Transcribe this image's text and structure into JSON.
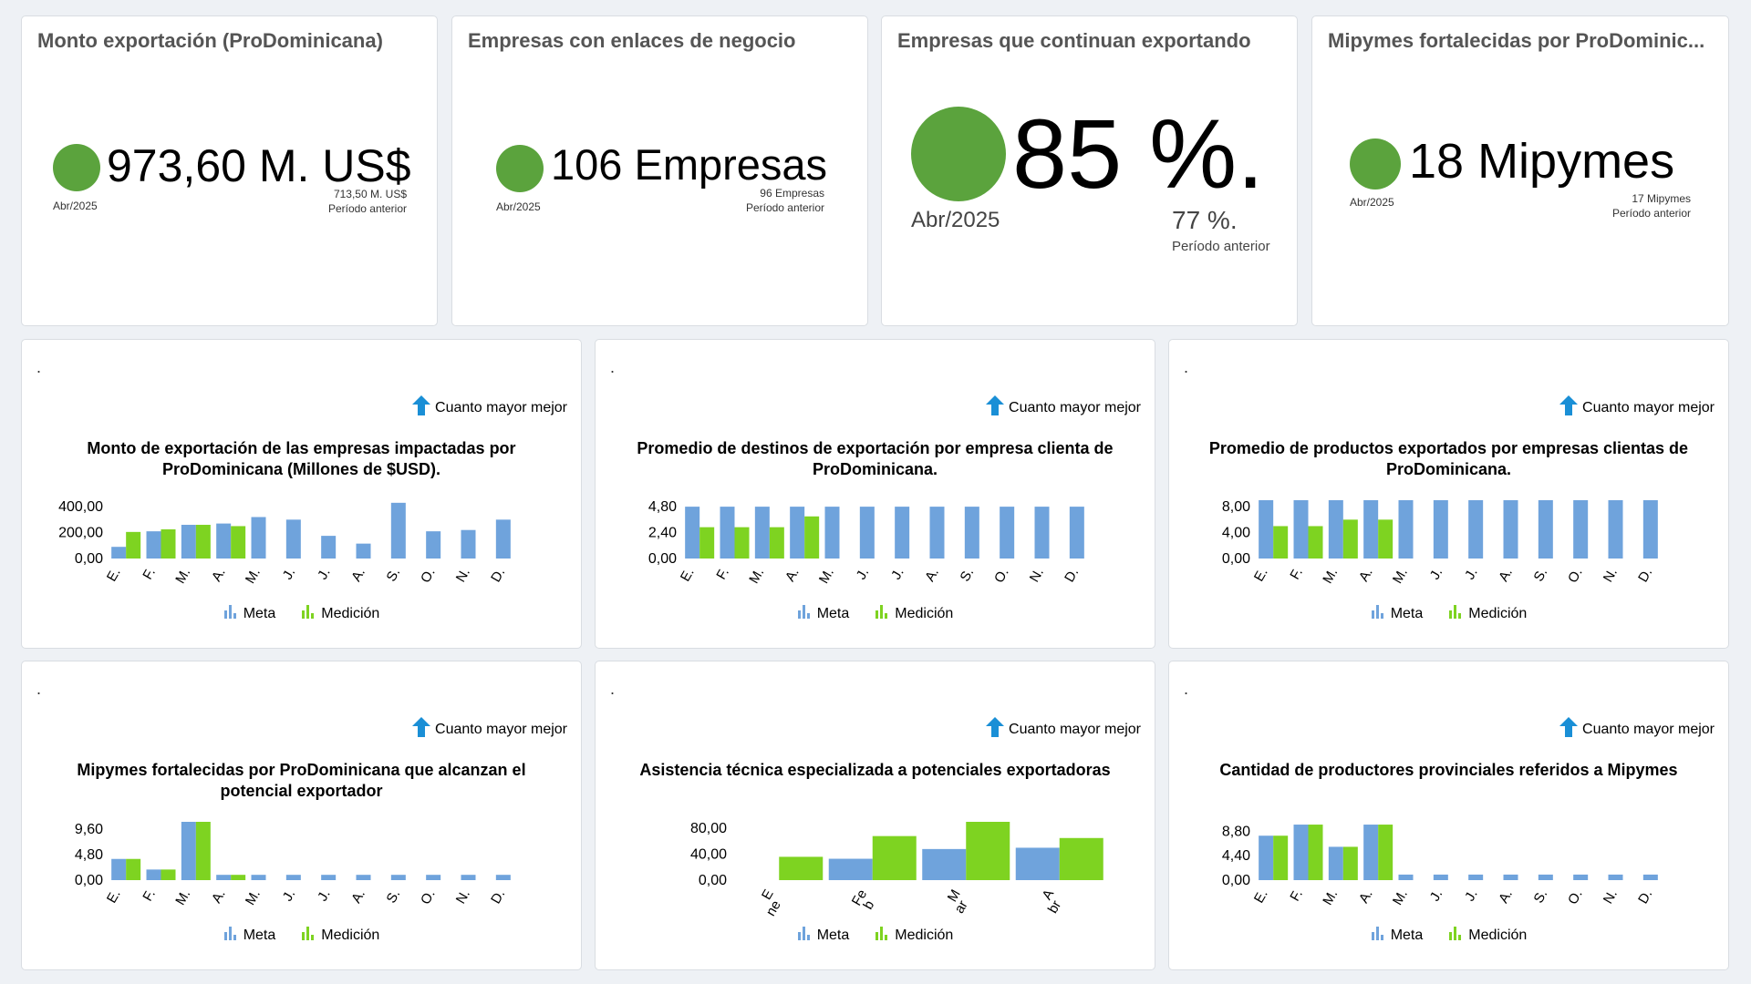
{
  "kpis": [
    {
      "title": "Monto exportación (ProDominicana)",
      "value": "973,60 M. US$",
      "period": "Abr/2025",
      "prev_value": "713,50 M. US$",
      "prev_label": "Período anterior"
    },
    {
      "title": "Empresas con enlaces de negocio",
      "value": "106 Empresas",
      "period": "Abr/2025",
      "prev_value": "96 Empresas",
      "prev_label": "Período anterior"
    },
    {
      "title": "Empresas que continuan exportando",
      "value": "85 %.",
      "period": "Abr/2025",
      "prev_value": "77 %.",
      "prev_label": "Período anterior"
    },
    {
      "title": "Mipymes fortalecidas por ProDominic...",
      "value": "18 Mipymes",
      "period": "Abr/2025",
      "prev_value": "17 Mipymes",
      "prev_label": "Período anterior"
    }
  ],
  "colors": {
    "meta": "#6fa3dc",
    "medicion": "#7ed321",
    "dot": "#5ba33d",
    "arrow": "#1a8fd6"
  },
  "legend": {
    "meta": "Meta",
    "medicion": "Medición"
  },
  "better_label": "Cuanto mayor mejor",
  "card_mark": ".",
  "chart_data": [
    {
      "type": "bar",
      "title": "Monto de exportación de las empresas impactadas por ProDominicana (Millones de $USD).",
      "categories": [
        "E.",
        "F.",
        "M.",
        "A.",
        "M.",
        "J.",
        "J.",
        "A.",
        "S.",
        "O.",
        "N.",
        "D."
      ],
      "ticks": [
        "400,00",
        "200,00",
        "0,00"
      ],
      "tick_values": [
        400,
        200,
        0
      ],
      "ylim": [
        0,
        450
      ],
      "series": [
        {
          "name": "Meta",
          "values": [
            90,
            210,
            260,
            270,
            320,
            300,
            175,
            115,
            430,
            210,
            220,
            300
          ]
        },
        {
          "name": "Medición",
          "values": [
            205,
            225,
            260,
            250,
            null,
            null,
            null,
            null,
            null,
            null,
            null,
            null
          ]
        }
      ]
    },
    {
      "type": "bar",
      "title": "Promedio de destinos de exportación por empresa clienta de ProDominicana.",
      "categories": [
        "E.",
        "F.",
        "M.",
        "A.",
        "M.",
        "J.",
        "J.",
        "A.",
        "S.",
        "O.",
        "N.",
        "D."
      ],
      "ticks": [
        "4,80",
        "2,40",
        "0,00"
      ],
      "tick_values": [
        4.8,
        2.4,
        0
      ],
      "ylim": [
        0,
        5.4
      ],
      "series": [
        {
          "name": "Meta",
          "values": [
            4.8,
            4.8,
            4.8,
            4.8,
            4.8,
            4.8,
            4.8,
            4.8,
            4.8,
            4.8,
            4.8,
            4.8
          ]
        },
        {
          "name": "Medición",
          "values": [
            2.9,
            2.9,
            2.9,
            3.9,
            null,
            null,
            null,
            null,
            null,
            null,
            null,
            null
          ]
        }
      ]
    },
    {
      "type": "bar",
      "title": "Promedio de productos exportados por empresas clientas de ProDominicana.",
      "categories": [
        "E.",
        "F.",
        "M.",
        "A.",
        "M.",
        "J.",
        "J.",
        "A.",
        "S.",
        "O.",
        "N.",
        "D."
      ],
      "ticks": [
        "8,00",
        "4,00",
        "0,00"
      ],
      "tick_values": [
        8,
        4,
        0
      ],
      "ylim": [
        0,
        9
      ],
      "series": [
        {
          "name": "Meta",
          "values": [
            9,
            9,
            9,
            9,
            9,
            9,
            9,
            9,
            9,
            9,
            9,
            9
          ]
        },
        {
          "name": "Medición",
          "values": [
            5,
            5,
            6,
            6,
            null,
            null,
            null,
            null,
            null,
            null,
            null,
            null
          ]
        }
      ]
    },
    {
      "type": "bar",
      "title": "Mipymes fortalecidas por ProDominicana que alcanzan el potencial exportador",
      "categories": [
        "E.",
        "F.",
        "M.",
        "A.",
        "M.",
        "J.",
        "J.",
        "A.",
        "S.",
        "O.",
        "N.",
        "D."
      ],
      "ticks": [
        "9,60",
        "4,80",
        "0,00"
      ],
      "tick_values": [
        9.6,
        4.8,
        0
      ],
      "ylim": [
        0,
        11
      ],
      "series": [
        {
          "name": "Meta",
          "values": [
            4,
            2,
            11,
            1,
            1,
            1,
            1,
            1,
            1,
            1,
            1,
            1
          ]
        },
        {
          "name": "Medición",
          "values": [
            4,
            2,
            11,
            1,
            null,
            null,
            null,
            null,
            null,
            null,
            null,
            null
          ]
        }
      ]
    },
    {
      "type": "bar",
      "title": "Asistencia técnica especializada a potenciales exportadoras",
      "categories": [
        "E\nne",
        "Fe\nb",
        "M\nar",
        "A\nbr"
      ],
      "ticks": [
        "80,00",
        "40,00",
        "0,00"
      ],
      "tick_values": [
        80,
        40,
        0
      ],
      "ylim": [
        0,
        90
      ],
      "series": [
        {
          "name": "Meta",
          "values": [
            null,
            33,
            48,
            50
          ]
        },
        {
          "name": "Medición",
          "values": [
            36,
            68,
            90,
            65
          ]
        }
      ]
    },
    {
      "type": "bar",
      "title": "Cantidad de productores provinciales referidos a Mipymes",
      "categories": [
        "E.",
        "F.",
        "M.",
        "A.",
        "M.",
        "J.",
        "J.",
        "A.",
        "S.",
        "O.",
        "N.",
        "D."
      ],
      "ticks": [
        "8,80",
        "4,40",
        "0,00"
      ],
      "tick_values": [
        8.8,
        4.4,
        0
      ],
      "ylim": [
        0,
        10.5
      ],
      "series": [
        {
          "name": "Meta",
          "values": [
            8,
            10,
            6,
            10,
            1,
            1,
            1,
            1,
            1,
            1,
            1,
            1
          ]
        },
        {
          "name": "Medición",
          "values": [
            8,
            10,
            6,
            10,
            null,
            null,
            null,
            null,
            null,
            null,
            null,
            null
          ]
        }
      ]
    }
  ]
}
